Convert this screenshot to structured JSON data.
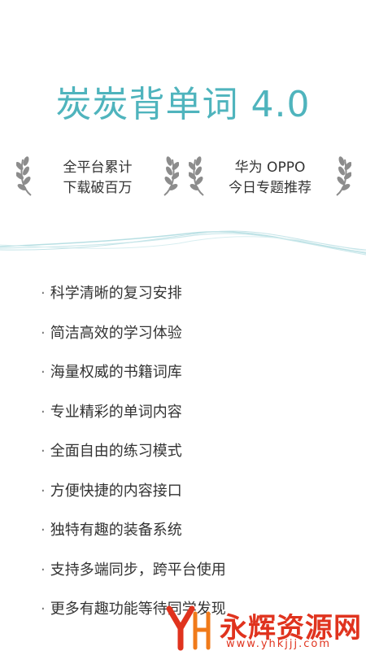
{
  "app": {
    "title": "炭炭背单词 4.0"
  },
  "awards": [
    {
      "line1": "全平台累计",
      "line2": "下载破百万"
    },
    {
      "line1": "华为 OPPO",
      "line2": "今日专题推荐"
    }
  ],
  "features": [
    "科学清晰的复习安排",
    "简洁高效的学习体验",
    "海量权威的书籍词库",
    "专业精彩的单词内容",
    "全面自由的练习模式",
    "方便快捷的内容接口",
    "独特有趣的装备系统",
    "支持多端同步，跨平台使用",
    "更多有趣功能等待同学发现"
  ],
  "bullet": "·",
  "watermark": {
    "name": "永辉资源网",
    "url": "www.yhkjjj.com"
  },
  "colors": {
    "accent": "#4fb4bd",
    "watermark": "#e0331e",
    "wreath": "#8c8c8c"
  },
  "icons": [
    "laurel-wreath-icon",
    "wave-decoration",
    "watermark-logo-icon"
  ]
}
